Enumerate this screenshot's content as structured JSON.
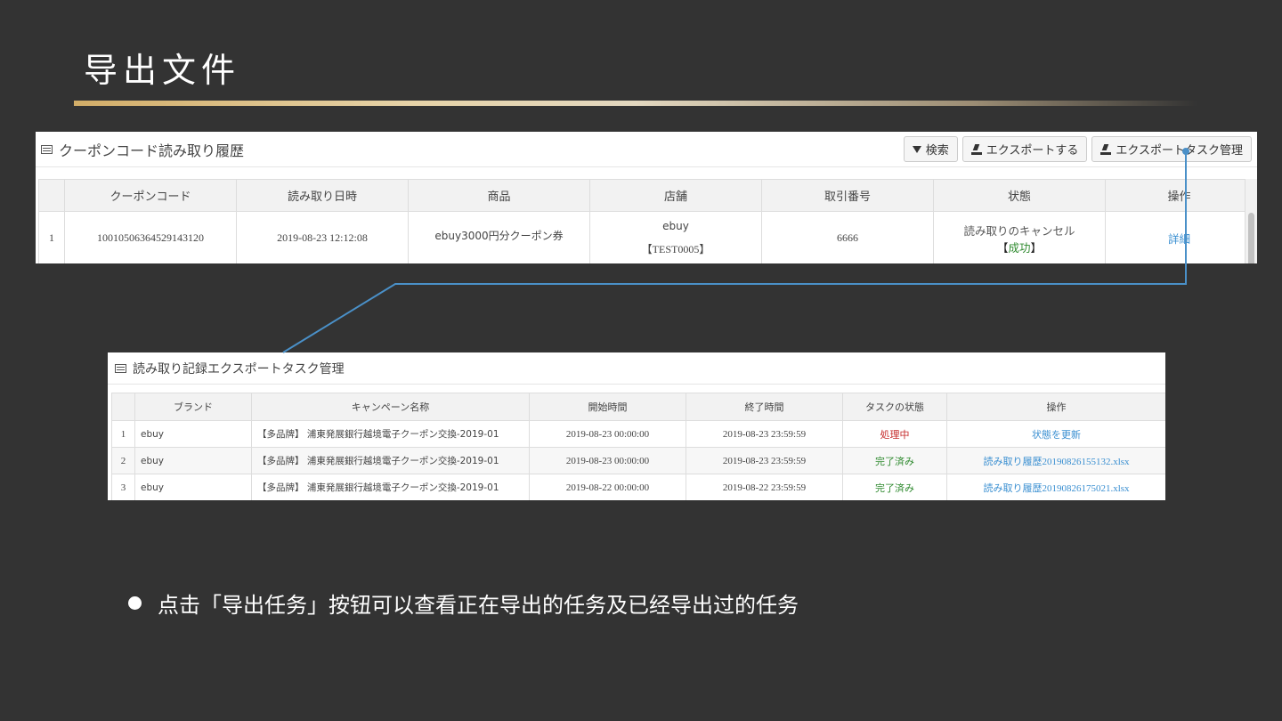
{
  "slide": {
    "title": "导出文件",
    "bullet": "点击「导出任务」按钮可以查看正在导出的任务及已经导出过的任务"
  },
  "history_panel": {
    "title": "クーポンコード読み取り履歴",
    "buttons": {
      "search": "検索",
      "export": "エクスポートする",
      "export_tasks": "エクスポートタスク管理"
    },
    "columns": [
      "クーポンコード",
      "読み取り日時",
      "商品",
      "店舗",
      "取引番号",
      "状態",
      "操作"
    ],
    "rows": [
      {
        "index": "1",
        "code": "10010506364529143120",
        "datetime": "2019-08-23 12:12:08",
        "product": "ebuy3000円分クーポン券",
        "store_name": "ebuy",
        "store_code": "【TEST0005】",
        "trade_no": "6666",
        "status": "読み取りのキャンセル",
        "status_open": "【",
        "status_result": "成功",
        "status_close": "】",
        "action": "詳細"
      }
    ]
  },
  "task_panel": {
    "title": "読み取り記録エクスポートタスク管理",
    "columns": [
      "ブランド",
      "キャンペーン名称",
      "開始時間",
      "終了時間",
      "タスクの状態",
      "操作"
    ],
    "rows": [
      {
        "index": "1",
        "brand": "ebuy",
        "campaign": "【多品牌】 浦東発展銀行越境電子クーポン交換-2019-01",
        "start": "2019-08-23 00:00:00",
        "end": "2019-08-23 23:59:59",
        "state": "処理中",
        "action": "状態を更新"
      },
      {
        "index": "2",
        "brand": "ebuy",
        "campaign": "【多品牌】 浦東発展銀行越境電子クーポン交換-2019-01",
        "start": "2019-08-23 00:00:00",
        "end": "2019-08-23 23:59:59",
        "state": "完了済み",
        "action": "読み取り履歴20190826155132.xlsx"
      },
      {
        "index": "3",
        "brand": "ebuy",
        "campaign": "【多品牌】 浦東発展銀行越境電子クーポン交換-2019-01",
        "start": "2019-08-22 00:00:00",
        "end": "2019-08-22 23:59:59",
        "state": "完了済み",
        "action": "読み取り履歴20190826175021.xlsx"
      }
    ]
  },
  "colors": {
    "background": "#333333",
    "connector": "#4a90c8",
    "link": "#3a8fd1",
    "processing": "#c52a2a",
    "done": "#2f8a2f"
  }
}
